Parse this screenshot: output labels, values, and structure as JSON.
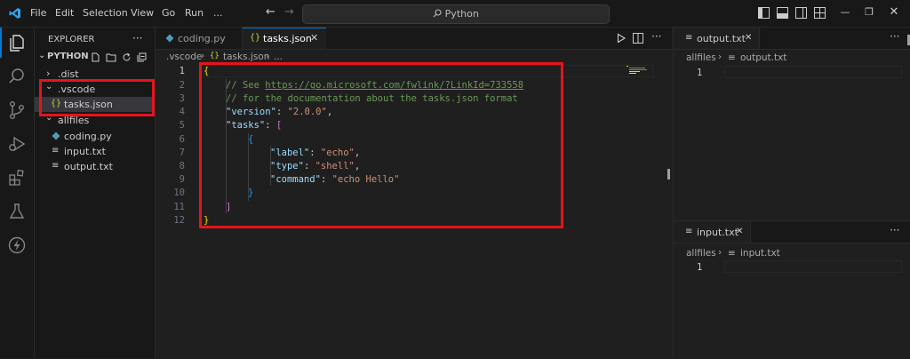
{
  "titlebar": {
    "menu": [
      "File",
      "Edit",
      "Selection",
      "View",
      "Go",
      "Run"
    ],
    "more": "...",
    "search_text": "Python"
  },
  "sidebar": {
    "title": "EXPLORER",
    "more": "···",
    "root": "PYTHON",
    "items": [
      {
        "label": ".dist",
        "kind": "folder-collapsed"
      },
      {
        "label": ".vscode",
        "kind": "folder-expanded"
      },
      {
        "label": "tasks.json",
        "kind": "json"
      },
      {
        "label": "allfiles",
        "kind": "folder-expanded"
      },
      {
        "label": "coding.py",
        "kind": "python"
      },
      {
        "label": "input.txt",
        "kind": "text"
      },
      {
        "label": "output.txt",
        "kind": "text"
      }
    ]
  },
  "editor": {
    "tabs": [
      {
        "label": "coding.py",
        "icon": "python-icon"
      },
      {
        "label": "tasks.json",
        "icon": "json-braces-icon",
        "active": true
      }
    ],
    "breadcrumb": [
      ".vscode",
      "tasks.json",
      "..."
    ],
    "code": {
      "l1": "{",
      "l2_comment": "// See ",
      "l2_link": "https://go.microsoft.com/fwlink/?LinkId=733558",
      "l3": "// for the documentation about the tasks.json format",
      "l4_key": "\"version\"",
      "l4_val": "\"2.0.0\"",
      "l5_key": "\"tasks\"",
      "l5_open": "[",
      "l6": "{",
      "l7_key": "\"label\"",
      "l7_val": "\"echo\"",
      "l8_key": "\"type\"",
      "l8_val": "\"shell\"",
      "l9_key": "\"command\"",
      "l9_val": "\"echo Hello\"",
      "l10": "}",
      "l11": "]",
      "l12": "}",
      "colon": ": ",
      "comma": ","
    },
    "line_numbers": [
      "1",
      "2",
      "3",
      "4",
      "5",
      "6",
      "7",
      "8",
      "9",
      "10",
      "11",
      "12"
    ]
  },
  "pane_top": {
    "tab_label": "output.txt",
    "breadcrumb_folder": "allfiles",
    "breadcrumb_file": "output.txt",
    "line_numbers": [
      "1"
    ]
  },
  "pane_bottom": {
    "tab_label": "input.txt",
    "breadcrumb_folder": "allfiles",
    "breadcrumb_file": "input.txt",
    "line_numbers": [
      "1"
    ]
  },
  "colors": {
    "highlight": "#e5141c",
    "accent": "#0078d4",
    "json_icon": "#cbcb41",
    "python_icon": "#519aba"
  }
}
